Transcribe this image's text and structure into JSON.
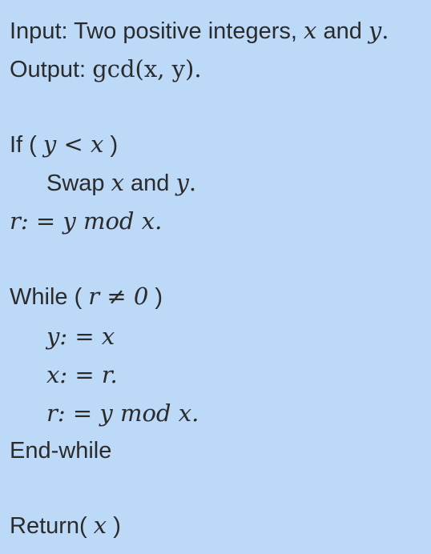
{
  "lines": {
    "input": {
      "prefix": "Input: Two positive integers,",
      "x": "x",
      "mid": "and",
      "y": "y",
      "end": "."
    },
    "output": {
      "prefix": "Output:",
      "expr": "gcd(x, y)."
    },
    "if": {
      "kw": "If (",
      "cond": "y < x",
      "close": ")"
    },
    "swap": {
      "kw": "Swap",
      "x": "x",
      "mid": "and",
      "y": "y",
      "end": "."
    },
    "r_assign1": {
      "expr": "r: = y mod x."
    },
    "while": {
      "kw": "While (",
      "cond": "r ≠ 0",
      "close": ")"
    },
    "y_assign": {
      "expr": "y: = x"
    },
    "x_assign": {
      "expr": "x: = r."
    },
    "r_assign2": {
      "expr": "r: = y mod x."
    },
    "endwhile": {
      "kw": "End-while"
    },
    "return": {
      "kw": "Return(",
      "x": "x",
      "close": ")"
    }
  }
}
